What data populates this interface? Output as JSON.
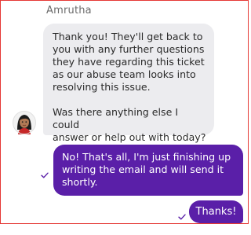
{
  "conversation": {
    "agent": {
      "name": "Amrutha",
      "message_paragraphs": [
        "Thank you! They'll get back to\nyou with any further questions\nthey have regarding this ticket\nas our abuse team looks into\nresolving this issue.",
        "Was there anything else I could\nanswer or help out with today?"
      ],
      "avatar_icon": "agent-avatar-icon"
    },
    "user_messages": [
      {
        "text": "No! That's all, I'm just finishing up\nwriting the email and will send it\nshortly.",
        "status_icon": "sent-check-icon"
      },
      {
        "text": "Thanks!",
        "status_icon": "sent-check-icon"
      }
    ]
  },
  "colors": {
    "user_bubble": "#5a1fa8",
    "agent_bubble": "#ececef",
    "frame_border": "#e53935"
  }
}
